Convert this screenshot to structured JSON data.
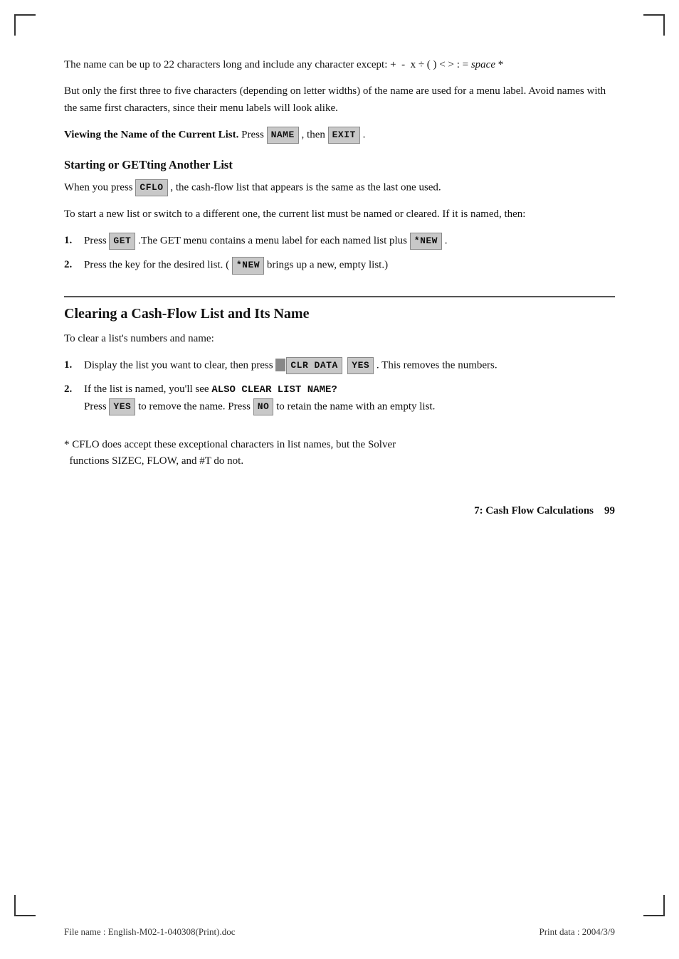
{
  "page": {
    "corner_marks": [
      "top-left",
      "top-right",
      "bottom-left",
      "bottom-right"
    ]
  },
  "content": {
    "intro_para1": "The name can be up to 22 characters long and include any character except: +  -  x ÷ ( ) < > : =",
    "intro_italic": "space",
    "intro_star": " *",
    "intro_para2": "But only the first three to five characters (depending on letter widths) of the name are used for a menu label. Avoid names with the same first characters, since their menu labels will look alike.",
    "viewing_label": "Viewing the Name of the Current List.",
    "viewing_text": " Press ",
    "viewing_key1": "NAME",
    "viewing_then": " , then ",
    "viewing_key2": "EXIT",
    "viewing_period": ".",
    "section1_heading": "Starting or GETting Another List",
    "section1_para1_pre": "When you press ",
    "section1_key1": "CFLO",
    "section1_para1_post": " , the cash-flow list that appears is the same as the last one used.",
    "section1_para2": "To start a new list or switch to a different one, the current list must be named or cleared. If it is named, then:",
    "list1": [
      {
        "num": "1.",
        "pre": "Press ",
        "key1": "GET",
        "post": " .The GET menu contains a menu label for each named list plus ",
        "key2": "*NEW",
        "post2": " ."
      },
      {
        "num": "2.",
        "pre": "Press the key for the desired list. ( ",
        "key1": "*NEW",
        "post": " brings up a new, empty list.)"
      }
    ],
    "major_section_heading": "Clearing a Cash-Flow List and Its Name",
    "major_para1": "To clear a list's numbers and name:",
    "list2": [
      {
        "num": "1.",
        "pre": "Display the list you want to clear, then press ",
        "has_shift": true,
        "key1": "CLR DATA",
        "key2": "YES",
        "post": " . This removes the numbers."
      },
      {
        "num": "2.",
        "pre": "If the list is named, you'll see ",
        "mono": "ALSO CLEAR LIST NAME?",
        "newline": true,
        "press_label": "Press",
        "key1": "YES",
        "mid": " to remove the name. Press ",
        "key2": "NO",
        "post": " to retain the name with an empty list."
      }
    ],
    "footnote": "* CFLO does accept these exceptional characters in list names, but the Solver\n  functions SIZEC, FLOW, and #T do not.",
    "page_chapter": "7: Cash Flow Calculations",
    "page_number": "99",
    "footer_filename": "File name : English-M02-1-040308(Print).doc",
    "footer_printdata": "Print data : 2004/3/9"
  }
}
